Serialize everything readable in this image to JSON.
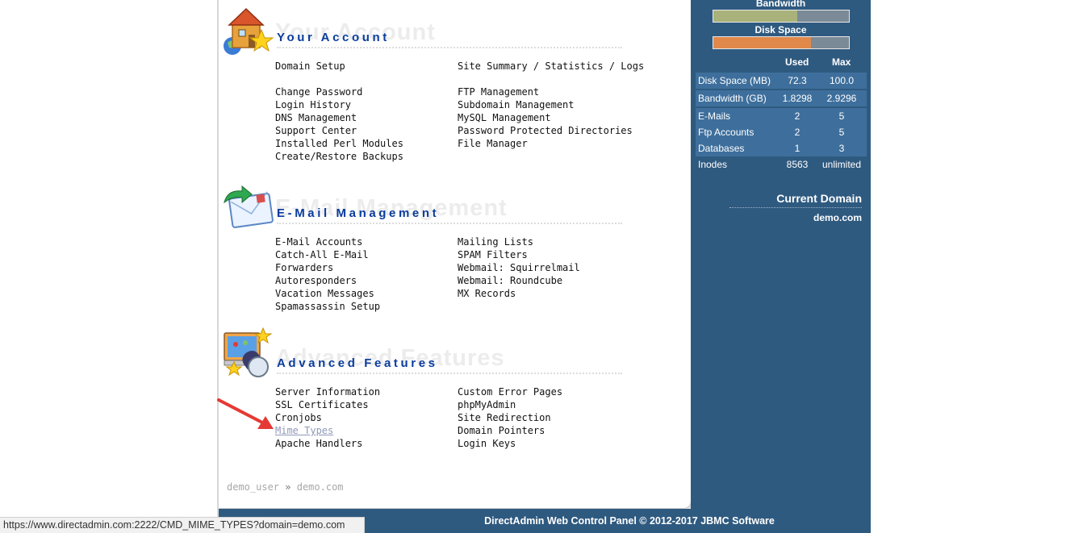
{
  "sections": {
    "account": {
      "title": "Your Account",
      "watermark": "Your Account",
      "col1": [
        "Domain Setup",
        "Change Password",
        "Login History",
        "DNS Management",
        "Support Center",
        "Installed Perl Modules",
        "Create/Restore Backups"
      ],
      "col2": [
        "Site Summary / Statistics / Logs",
        "FTP Management",
        "Subdomain Management",
        "MySQL Management",
        "Password Protected Directories",
        "File Manager"
      ]
    },
    "email": {
      "title": "E-Mail Management",
      "watermark": "E-Mail Management",
      "col1": [
        "E-Mail Accounts",
        "Catch-All E-Mail",
        "Forwarders",
        "Autoresponders",
        "Vacation Messages",
        "Spamassassin Setup"
      ],
      "col2": [
        "Mailing Lists",
        "SPAM Filters",
        "Webmail: Squirrelmail",
        "Webmail: Roundcube",
        "MX Records"
      ]
    },
    "advanced": {
      "title": "Advanced Features",
      "watermark": "Advanced Features",
      "col1": [
        "Server Information",
        "SSL Certificates",
        "Cronjobs",
        "Mime Types",
        "Apache Handlers"
      ],
      "col2": [
        "Custom Error Pages",
        "phpMyAdmin",
        "Site Redirection",
        "Domain Pointers",
        "Login Keys"
      ]
    }
  },
  "breadcrumb": {
    "user": "demo_user",
    "separator": "»",
    "domain": "demo.com"
  },
  "footer": "DirectAdmin Web Control Panel © 2012-2017 JBMC Software",
  "status_bar_url": "https://www.directadmin.com:2222/CMD_MIME_TYPES?domain=demo.com",
  "meters": {
    "bandwidth": {
      "label": "Bandwidth",
      "fraction": 0.62,
      "color": "#a9b27a"
    },
    "disk": {
      "label": "Disk Space",
      "fraction": 0.72,
      "color": "#e0894a"
    }
  },
  "usage": {
    "headers": {
      "used": "Used",
      "max": "Max"
    },
    "rows": [
      {
        "label": "Disk Space (MB)",
        "used": "72.3",
        "max": "100.0"
      },
      {
        "label": "Bandwidth (GB)",
        "used": "1.8298",
        "max": "2.9296"
      },
      {
        "label": "E-Mails",
        "used": "2",
        "max": "5"
      },
      {
        "label": "Ftp Accounts",
        "used": "2",
        "max": "5"
      },
      {
        "label": "Databases",
        "used": "1",
        "max": "3"
      },
      {
        "label": "Inodes",
        "used": "8563",
        "max": "unlimited"
      }
    ]
  },
  "current_domain": {
    "title": "Current Domain",
    "value": "demo.com"
  },
  "colors": {
    "accent": "#0a3d9e",
    "sidebar": "#2f5a80",
    "arrow": "#e53935"
  }
}
